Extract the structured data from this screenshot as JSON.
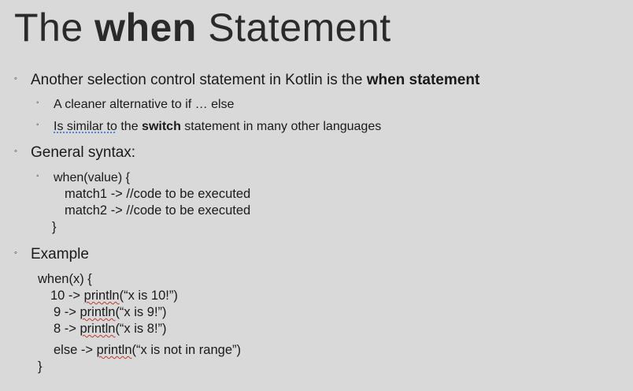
{
  "title": {
    "prefix": "The ",
    "bold": "when",
    "suffix": " Statement"
  },
  "bullets": {
    "b1": {
      "text": "Another selection control statement in Kotlin is the ",
      "bold": "when statement"
    },
    "b1a": "A cleaner alternative to if … else",
    "b1b": {
      "underlined": "Is similar to",
      "middle": " the ",
      "bold": "switch",
      "end": " statement in many other languages"
    },
    "b2": "General syntax:",
    "b2a_line1": "when(value) {",
    "b2a_line2": "match1 -> //code to be executed",
    "b2a_line3": "match2 -> //code to be executed",
    "b2a_line4": "}",
    "b3": "Example"
  },
  "example": {
    "l1": "when(x) {",
    "l2_pre": "10 -> ",
    "l2_fn": "println",
    "l2_arg": "(“x is 10!”)",
    "l3_pre": "9 -> ",
    "l3_fn": "println",
    "l3_arg": "(“x is 9!”)",
    "l4_pre": "8 -> ",
    "l4_fn": "println",
    "l4_arg": "(“x is 8!”)",
    "l5_pre": "else -> ",
    "l5_fn": "println",
    "l5_arg": "(“x is not in range”)",
    "l6": "}"
  },
  "glyphs": {
    "bullet": "◦"
  },
  "colors": {
    "background": "#d9d9d9",
    "text": "#1a1a1a",
    "spellcheck": "#c0392b"
  }
}
